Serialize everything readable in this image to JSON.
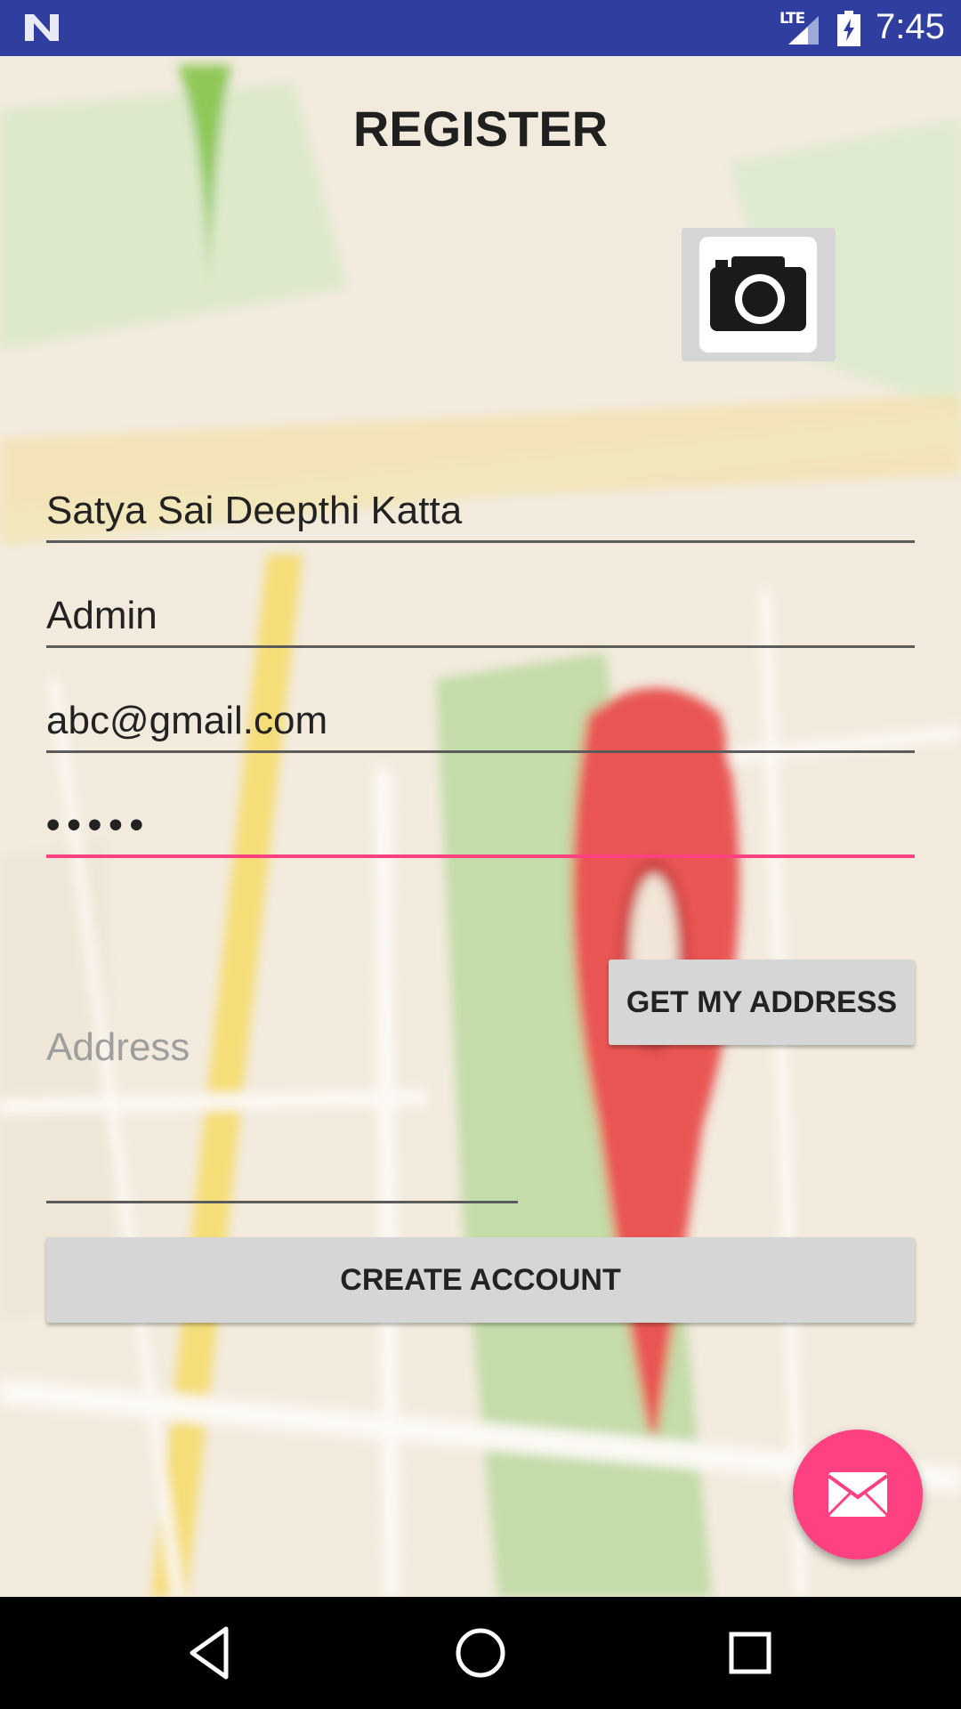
{
  "status_bar": {
    "network": "LTE",
    "time": "7:45"
  },
  "page": {
    "title": "REGISTER"
  },
  "form": {
    "name": "Satya Sai Deepthi Katta",
    "role": "Admin",
    "email": "abc@gmail.com",
    "password": "•••••",
    "address_placeholder": "Address"
  },
  "buttons": {
    "get_address": "GET MY ADDRESS",
    "create_account": "CREATE ACCOUNT"
  },
  "icons": {
    "camera": "camera-icon",
    "fab": "mail-icon",
    "nav_back": "back-icon",
    "nav_home": "home-icon",
    "nav_recent": "recent-apps-icon"
  },
  "colors": {
    "status_bar": "#303f9f",
    "accent": "#ff4081",
    "button": "#d6d6d6"
  }
}
